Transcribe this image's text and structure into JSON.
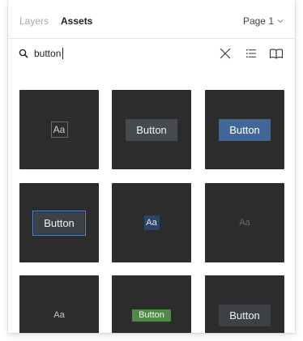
{
  "tabs": {
    "layers": "Layers",
    "assets": "Assets",
    "page": "Page 1"
  },
  "search": {
    "value": "button",
    "placeholder": ""
  },
  "tiles": [
    {
      "label": "Aa",
      "style": "outline"
    },
    {
      "label": "Button",
      "style": "gray"
    },
    {
      "label": "Button",
      "style": "blue"
    },
    {
      "label": "Button",
      "style": "selected"
    },
    {
      "label": "Aa",
      "style": "navy"
    },
    {
      "label": "Aa",
      "style": "dim"
    },
    {
      "label": "Aa",
      "style": "light"
    },
    {
      "label": "Button",
      "style": "green"
    },
    {
      "label": "Button",
      "style": "charcoal"
    }
  ],
  "colors": {
    "tile_bg": "#2c2c2c",
    "button_blue": "#3f6797",
    "button_green": "#4f8a47",
    "button_gray": "#474a4f",
    "selection_outline": "#5a88c9"
  },
  "icons": [
    "search-icon",
    "clear-icon",
    "list-view-icon",
    "library-book-icon",
    "chevron-down-icon"
  ]
}
